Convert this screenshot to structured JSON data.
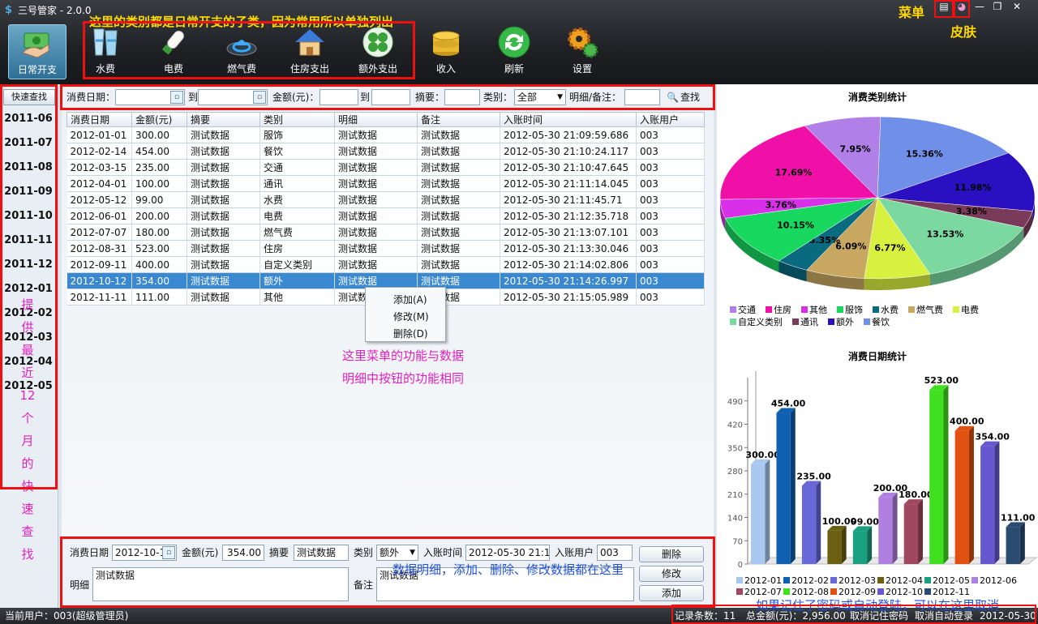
{
  "app": {
    "title": "三号管家 - 2.0.0"
  },
  "toolbar": {
    "items": [
      {
        "label": "日常开支",
        "icon": "money-hand-icon"
      },
      {
        "label": "水费",
        "icon": "water-glass-icon"
      },
      {
        "label": "电费",
        "icon": "light-bulb-icon"
      },
      {
        "label": "燃气费",
        "icon": "gas-flame-icon"
      },
      {
        "label": "住房支出",
        "icon": "house-icon"
      },
      {
        "label": "额外支出",
        "icon": "clover-icon"
      },
      {
        "label": "收入",
        "icon": "coins-icon"
      },
      {
        "label": "刷新",
        "icon": "refresh-icon"
      },
      {
        "label": "设置",
        "icon": "gears-icon"
      }
    ]
  },
  "annotations": {
    "toolbar_note": "这里的类别都是日常开支的子类，因为常用所以单独列出",
    "menu_label": "菜单",
    "skin_label": "皮肤",
    "quick_note": "提供最近12个月的快速查找",
    "context_note_1": "这里菜单的功能与数据",
    "context_note_2": "明细中按钮的功能相同",
    "detail_note": "数据明细，添加、删除、修改数据都在这里",
    "status_note": "如果记住了密码或自动登陆，可以在这里取消"
  },
  "quick": {
    "button": "快速查找",
    "months": [
      "2011-06",
      "2011-07",
      "2011-08",
      "2011-09",
      "2011-10",
      "2011-11",
      "2011-12",
      "2012-01",
      "2012-02",
      "2012-03",
      "2012-04",
      "2012-05"
    ]
  },
  "search": {
    "date_label": "消费日期：",
    "to1": "到",
    "amount_label": "金额(元)：",
    "to2": "到",
    "summary_label": "摘要：",
    "category_label": "类别：",
    "category_value": "全部",
    "detail_label": "明细/备注：",
    "search_button": "查找"
  },
  "table": {
    "columns": [
      "消费日期",
      "金额(元)",
      "摘要",
      "类别",
      "明细",
      "备注",
      "入账时间",
      "入账用户"
    ],
    "rows": [
      [
        "2012-01-01",
        "300.00",
        "测试数据",
        "服饰",
        "测试数据",
        "测试数据",
        "2012-05-30 21:09:59.686",
        "003"
      ],
      [
        "2012-02-14",
        "454.00",
        "测试数据",
        "餐饮",
        "测试数据",
        "测试数据",
        "2012-05-30 21:10:24.117",
        "003"
      ],
      [
        "2012-03-15",
        "235.00",
        "测试数据",
        "交通",
        "测试数据",
        "测试数据",
        "2012-05-30 21:10:47.645",
        "003"
      ],
      [
        "2012-04-01",
        "100.00",
        "测试数据",
        "通讯",
        "测试数据",
        "测试数据",
        "2012-05-30 21:11:14.045",
        "003"
      ],
      [
        "2012-05-12",
        "99.00",
        "测试数据",
        "水费",
        "测试数据",
        "测试数据",
        "2012-05-30 21:11:45.71",
        "003"
      ],
      [
        "2012-06-01",
        "200.00",
        "测试数据",
        "电费",
        "测试数据",
        "测试数据",
        "2012-05-30 21:12:35.718",
        "003"
      ],
      [
        "2012-07-07",
        "180.00",
        "测试数据",
        "燃气费",
        "测试数据",
        "测试数据",
        "2012-05-30 21:13:07.101",
        "003"
      ],
      [
        "2012-08-31",
        "523.00",
        "测试数据",
        "住房",
        "测试数据",
        "测试数据",
        "2012-05-30 21:13:30.046",
        "003"
      ],
      [
        "2012-09-11",
        "400.00",
        "测试数据",
        "自定义类别",
        "测试数据",
        "测试数据",
        "2012-05-30 21:14:02.806",
        "003"
      ],
      [
        "2012-10-12",
        "354.00",
        "测试数据",
        "额外",
        "测试数据",
        "测试数据",
        "2012-05-30 21:14:26.997",
        "003"
      ],
      [
        "2012-11-11",
        "111.00",
        "测试数据",
        "其他",
        "测试数据",
        "测试数据",
        "2012-05-30 21:15:05.989",
        "003"
      ]
    ],
    "selected_row": 9
  },
  "context_menu": {
    "add": "添加(A)",
    "edit": "修改(M)",
    "delete": "删除(D)"
  },
  "detail": {
    "date_label": "消费日期",
    "date_value": "2012-10-1",
    "amount_label": "金额(元)",
    "amount_value": "354.00",
    "summary_label": "摘要",
    "summary_value": "测试数据",
    "category_label": "类别",
    "category_value": "额外",
    "time_label": "入账时间",
    "time_value": "2012-05-30 21:1",
    "user_label": "入账用户",
    "user_value": "003",
    "detail_label": "明细",
    "detail_value": "测试数据",
    "note_label": "备注",
    "note_value": "测试数据",
    "delete_button": "删除",
    "edit_button": "修改",
    "add_button": "添加"
  },
  "status": {
    "user": "当前用户：003(超级管理员)",
    "count": "记录条数：11",
    "total": "总金额(元)：2,956.00",
    "cancel_password": "取消记住密码",
    "cancel_autologin": "取消自动登录",
    "date": "2012-05-30"
  },
  "chart_data": [
    {
      "type": "pie",
      "title": "消费类别统计",
      "slices": [
        {
          "name": "餐饮",
          "value": 15.36,
          "color": "#6f8fe8"
        },
        {
          "name": "额外",
          "value": 11.98,
          "color": "#2a10c0"
        },
        {
          "name": "通讯",
          "value": 3.38,
          "color": "#7a3a5a"
        },
        {
          "name": "自定义类别",
          "value": 13.53,
          "color": "#7ad8a0"
        },
        {
          "name": "电费",
          "value": 6.77,
          "color": "#d8f040"
        },
        {
          "name": "燃气费",
          "value": 6.09,
          "color": "#c8a860"
        },
        {
          "name": "水费",
          "value": 3.35,
          "color": "#0a6a80"
        },
        {
          "name": "服饰",
          "value": 10.15,
          "color": "#18d860"
        },
        {
          "name": "其他",
          "value": 3.76,
          "color": "#d830e8"
        },
        {
          "name": "住房",
          "value": 17.69,
          "color": "#f010a8"
        },
        {
          "name": "交通",
          "value": 7.95,
          "color": "#b080e8"
        }
      ],
      "legend": [
        {
          "name": "交通",
          "color": "#b080e8"
        },
        {
          "name": "住房",
          "color": "#f010a8"
        },
        {
          "name": "其他",
          "color": "#d830e8"
        },
        {
          "name": "服饰",
          "color": "#18d860"
        },
        {
          "name": "水费",
          "color": "#0a6a80"
        },
        {
          "name": "燃气费",
          "color": "#c8a860"
        },
        {
          "name": "电费",
          "color": "#d8f040"
        },
        {
          "name": "自定义类别",
          "color": "#7ad8a0"
        },
        {
          "name": "通讯",
          "color": "#7a3a5a"
        },
        {
          "name": "额外",
          "color": "#2a10c0"
        },
        {
          "name": "餐饮",
          "color": "#6f8fe8"
        }
      ],
      "legend_position": "bottom"
    },
    {
      "type": "bar",
      "title": "消费日期统计",
      "categories": [
        "2012-01",
        "2012-02",
        "2012-03",
        "2012-04",
        "2012-05",
        "2012-06",
        "2012-07",
        "2012-08",
        "2012-09",
        "2012-10",
        "2012-11"
      ],
      "values": [
        300,
        454,
        235,
        100,
        99,
        200,
        180,
        523,
        400,
        354,
        111
      ],
      "value_labels": [
        "300.00",
        "454.00",
        "235.00",
        "100.00",
        "99.00",
        "200.00",
        "180.00",
        "523.00",
        "400.00",
        "354.00",
        "111.00"
      ],
      "colors": [
        "#a8c8f0",
        "#1060b0",
        "#6868d8",
        "#6a6010",
        "#18a080",
        "#b080e0",
        "#a04860",
        "#40e020",
        "#e05010",
        "#6858d0",
        "#2a4a70"
      ],
      "yticks": [
        0,
        70,
        140,
        210,
        280,
        350,
        420,
        490
      ],
      "ylim": [
        0,
        560
      ],
      "grid": false,
      "legend_position": "bottom"
    }
  ]
}
